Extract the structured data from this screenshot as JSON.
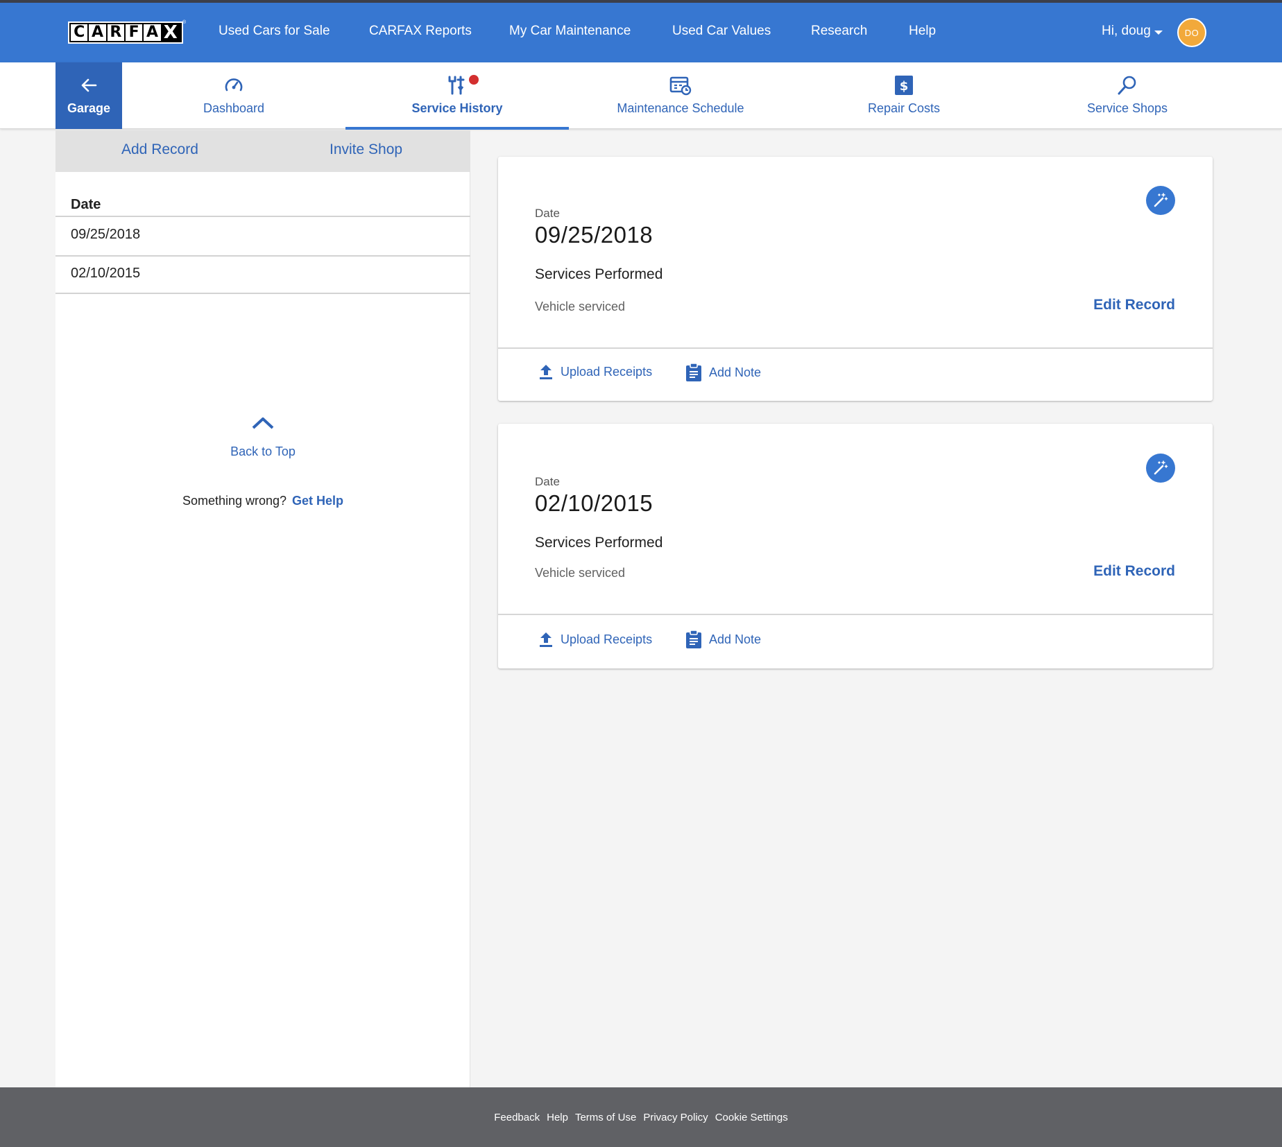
{
  "header": {
    "logo_letters": [
      "C",
      "A",
      "R",
      "F",
      "A",
      "X"
    ],
    "logo_tm": "®",
    "nav": [
      {
        "label": "Used Cars for Sale"
      },
      {
        "label": "CARFAX Reports"
      },
      {
        "label": "My Car Maintenance"
      },
      {
        "label": "Used Car Values"
      },
      {
        "label": "Research"
      },
      {
        "label": "Help"
      }
    ],
    "greeting": "Hi, doug",
    "avatar_initials": "DO"
  },
  "subnav": {
    "garage_label": "Garage",
    "tabs": [
      {
        "label": "Dashboard",
        "icon": "speedometer-icon"
      },
      {
        "label": "Service History",
        "icon": "tools-icon",
        "active": true
      },
      {
        "label": "Maintenance Schedule",
        "icon": "calendar-clock-icon"
      },
      {
        "label": "Repair Costs",
        "icon": "dollar-icon"
      },
      {
        "label": "Service Shops",
        "icon": "search-icon"
      }
    ]
  },
  "left_panel": {
    "add_record": "Add Record",
    "invite_shop": "Invite Shop",
    "date_header": "Date",
    "dates": [
      "09/25/2018",
      "02/10/2015"
    ],
    "back_to_top": "Back to Top",
    "help_text": "Something wrong?",
    "help_link": "Get Help"
  },
  "records": [
    {
      "date_label": "Date",
      "date": "09/25/2018",
      "services_label": "Services Performed",
      "description": "Vehicle serviced",
      "edit_label": "Edit Record",
      "upload_label": "Upload Receipts",
      "note_label": "Add Note"
    },
    {
      "date_label": "Date",
      "date": "02/10/2015",
      "services_label": "Services Performed",
      "description": "Vehicle serviced",
      "edit_label": "Edit Record",
      "upload_label": "Upload Receipts",
      "note_label": "Add Note"
    }
  ],
  "footer": {
    "links": [
      "Feedback",
      "Help",
      "Terms of Use",
      "Privacy Policy",
      "Cookie Settings"
    ]
  },
  "colors": {
    "header_blue": "#3777d1",
    "link_blue": "#2f64b7",
    "avatar_orange": "#f2a93b",
    "notify_red": "#d32f2f",
    "footer_gray": "#606165"
  }
}
